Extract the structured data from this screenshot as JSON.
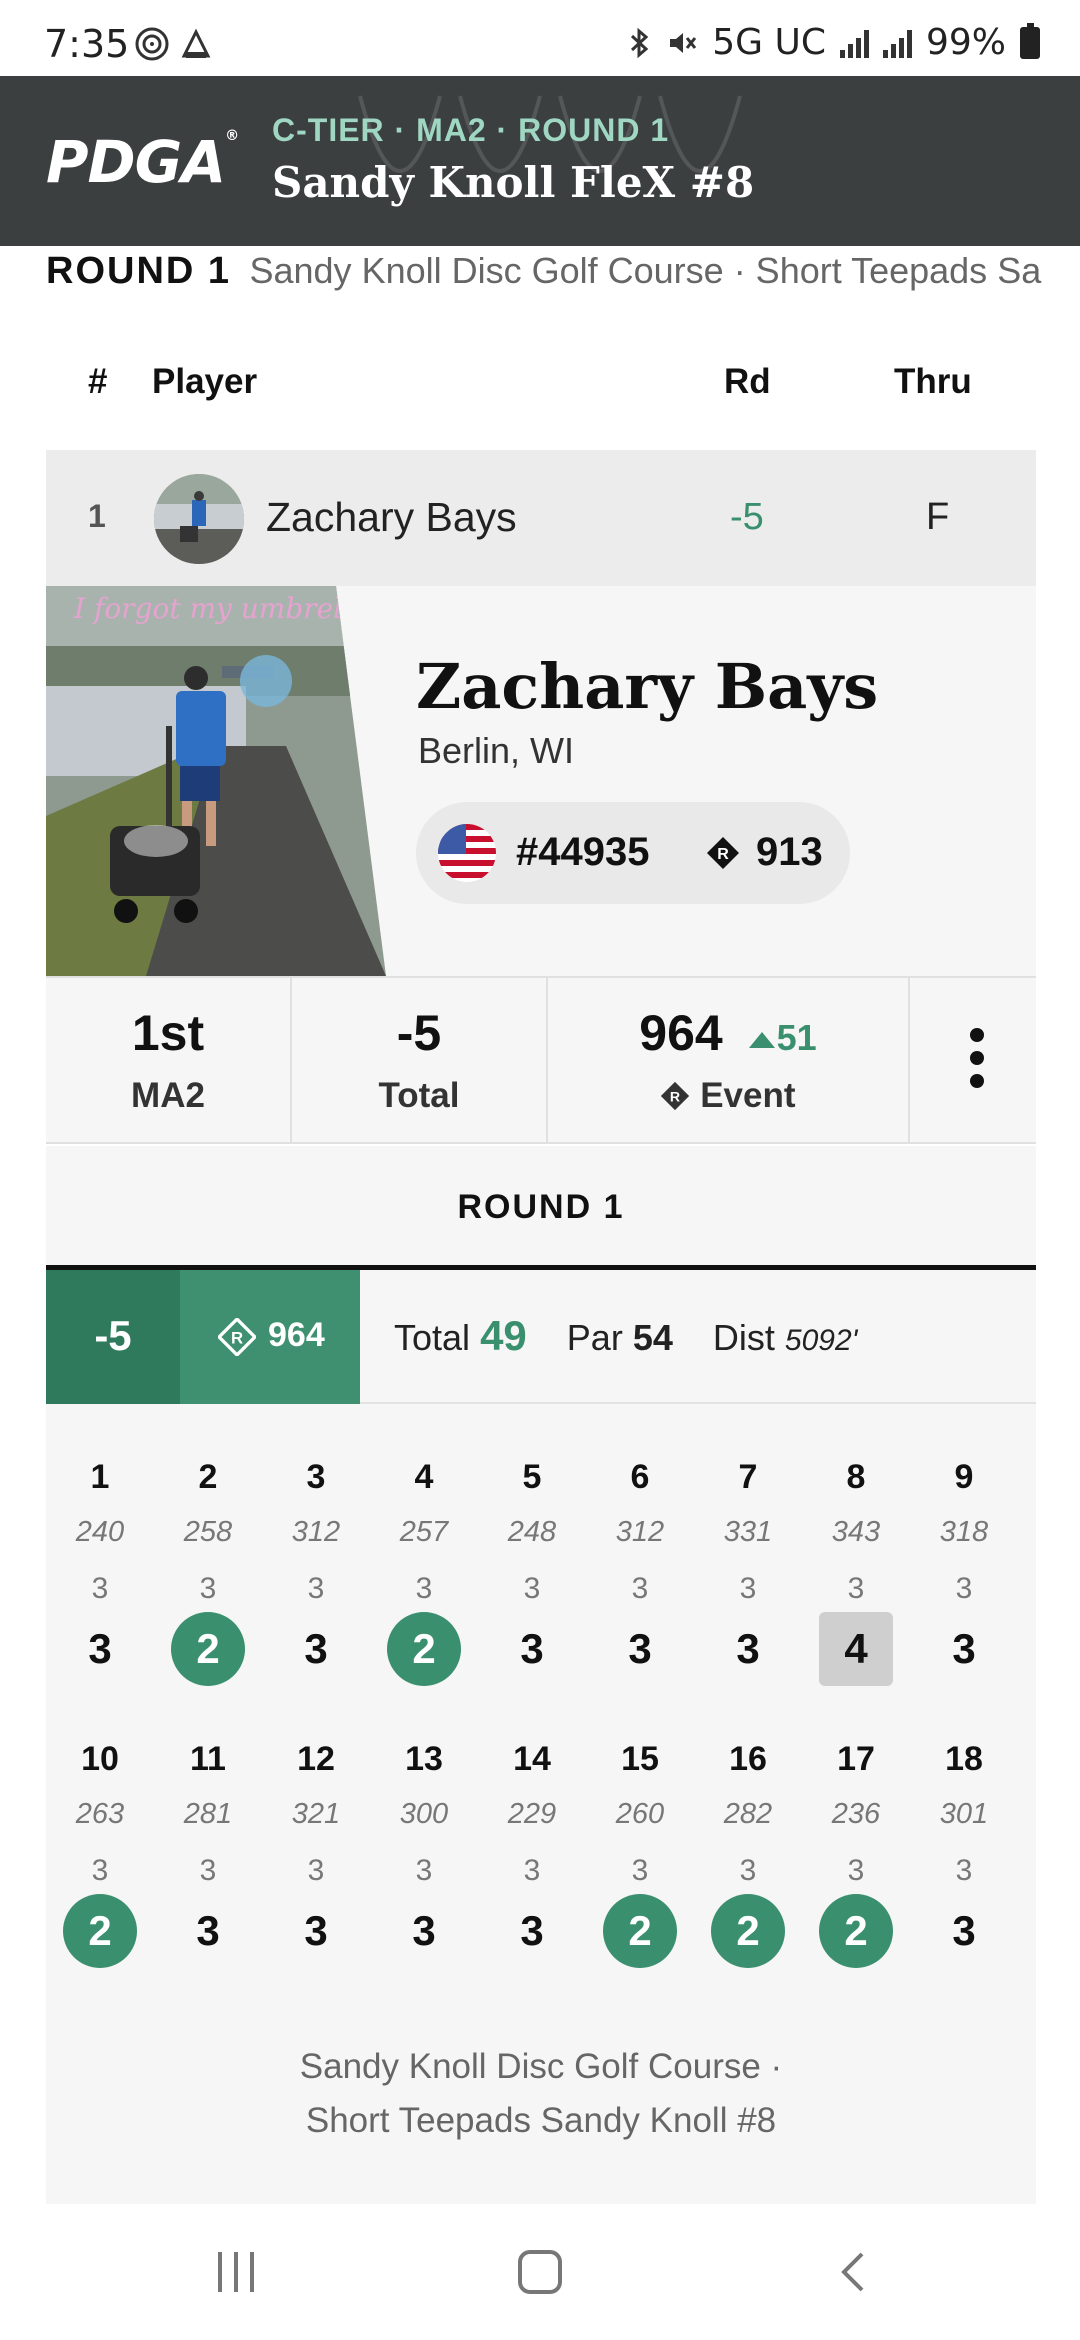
{
  "status_bar": {
    "time": "7:35",
    "network": "5G UC",
    "battery": "99%"
  },
  "header": {
    "logo": "PDGA",
    "tier_line": "C-TIER · MA2 · ROUND 1",
    "event_title": "Sandy Knoll FleX #8"
  },
  "round_bar": {
    "label": "ROUND 1",
    "course": "Sandy Knoll Disc Golf Course · Short Teepads Sa"
  },
  "columns": {
    "num": "#",
    "player": "Player",
    "rd": "Rd",
    "thru": "Thru"
  },
  "player_row": {
    "place": "1",
    "name": "Zachary Bays",
    "rd": "-5",
    "thru": "F"
  },
  "profile": {
    "photo_caption": "I forgot my umbrella",
    "name": "Zachary Bays",
    "location": "Berlin, WI",
    "pdga_number": "#44935",
    "rating": "913"
  },
  "stats": {
    "place": "1st",
    "division": "MA2",
    "total": "-5",
    "total_label": "Total",
    "event_rating": "964",
    "rating_delta": "51",
    "event_label": "Event"
  },
  "round_tab": "ROUND 1",
  "summary": {
    "score": "-5",
    "rating": "964",
    "total_label": "Total",
    "total": "49",
    "par_label": "Par",
    "par": "54",
    "dist_label": "Dist",
    "dist": "5092'"
  },
  "holes": [
    {
      "n": "1",
      "d": "240",
      "p": "3",
      "s": "3",
      "t": "par"
    },
    {
      "n": "2",
      "d": "258",
      "p": "3",
      "s": "2",
      "t": "birdie"
    },
    {
      "n": "3",
      "d": "312",
      "p": "3",
      "s": "3",
      "t": "par"
    },
    {
      "n": "4",
      "d": "257",
      "p": "3",
      "s": "2",
      "t": "birdie"
    },
    {
      "n": "5",
      "d": "248",
      "p": "3",
      "s": "3",
      "t": "par"
    },
    {
      "n": "6",
      "d": "312",
      "p": "3",
      "s": "3",
      "t": "par"
    },
    {
      "n": "7",
      "d": "331",
      "p": "3",
      "s": "3",
      "t": "par"
    },
    {
      "n": "8",
      "d": "343",
      "p": "3",
      "s": "4",
      "t": "bogey"
    },
    {
      "n": "9",
      "d": "318",
      "p": "3",
      "s": "3",
      "t": "par"
    },
    {
      "n": "10",
      "d": "263",
      "p": "3",
      "s": "2",
      "t": "birdie"
    },
    {
      "n": "11",
      "d": "281",
      "p": "3",
      "s": "3",
      "t": "par"
    },
    {
      "n": "12",
      "d": "321",
      "p": "3",
      "s": "3",
      "t": "par"
    },
    {
      "n": "13",
      "d": "300",
      "p": "3",
      "s": "3",
      "t": "par"
    },
    {
      "n": "14",
      "d": "229",
      "p": "3",
      "s": "3",
      "t": "par"
    },
    {
      "n": "15",
      "d": "260",
      "p": "3",
      "s": "2",
      "t": "birdie"
    },
    {
      "n": "16",
      "d": "282",
      "p": "3",
      "s": "2",
      "t": "birdie"
    },
    {
      "n": "17",
      "d": "236",
      "p": "3",
      "s": "2",
      "t": "birdie"
    },
    {
      "n": "18",
      "d": "301",
      "p": "3",
      "s": "3",
      "t": "par"
    }
  ],
  "footer": {
    "line1": "Sandy Knoll Disc Golf Course ·",
    "line2": "Short Teepads Sandy Knoll #8"
  },
  "colors": {
    "header_bg": "#3b3f40",
    "accent_green": "#3a8f6e",
    "dark_green": "#2f7a5d",
    "bogey_gray": "#cfcfcf"
  }
}
